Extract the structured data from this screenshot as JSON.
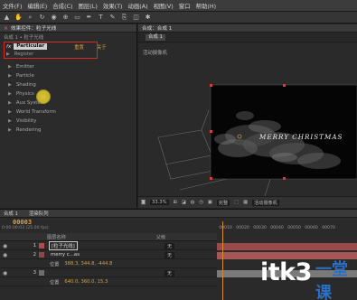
{
  "menu": {
    "items": [
      "文件(F)",
      "编辑(E)",
      "合成(C)",
      "图层(L)",
      "效果(T)",
      "动画(A)",
      "视图(V)",
      "窗口",
      "帮助(H)"
    ]
  },
  "toolbar": {
    "tools": [
      "selection-tool",
      "hand-tool",
      "zoom-tool",
      "rotate-tool",
      "camera-tool",
      "pan-tool",
      "rectangle-tool",
      "pen-tool",
      "text-tool",
      "brush-tool",
      "clone-tool",
      "eraser-tool",
      "puppet-tool"
    ]
  },
  "effect_panel": {
    "tab_label": "效果控件：粒子光线",
    "path": "合成 1 • 粒子光线",
    "fx_label": "fx",
    "effect_name": "Particular",
    "reset_label": "重置",
    "about_label": "关于",
    "register_label": "Register",
    "properties": [
      "Emitter",
      "Particle",
      "Shading",
      "Physics",
      "Aux System",
      "World Transform",
      "Visibility",
      "Rendering"
    ]
  },
  "comp_panel": {
    "tab_label": "合成：合成 1",
    "sub_tab": "合成 1",
    "view_label": "活动摄像机",
    "merry_text": "MERRY CHRISTMAS",
    "footer": {
      "zoom": "33.3%",
      "quality": "完整",
      "camera": "活动摄像机"
    }
  },
  "timeline": {
    "tabs": [
      "合成 1",
      "渲染队列"
    ],
    "timecode": "00003",
    "timecode_sub": "0:00:00:03 (25.00 fps)",
    "column_header": "图层名称",
    "parent_header": "父级",
    "ruler": [
      "00010",
      "00020",
      "00030",
      "00040",
      "00050",
      "00060",
      "00070"
    ],
    "layers": [
      {
        "num": "1",
        "name": "[粒子光线]",
        "parent": "无",
        "selected": true
      },
      {
        "num": "2",
        "name": "merry c...as",
        "parent": "无",
        "selected": false
      },
      {
        "num": "",
        "name": "位置",
        "parent": "",
        "value": "388.3, 344.8, -444.8"
      },
      {
        "num": "3",
        "name": "",
        "parent": "无",
        "selected": false
      },
      {
        "num": "",
        "name": "位置",
        "parent": "",
        "value": "640.0, 360.0, 15.3"
      }
    ]
  },
  "watermark": {
    "text": "itk3",
    "cn_text": "一堂课"
  }
}
